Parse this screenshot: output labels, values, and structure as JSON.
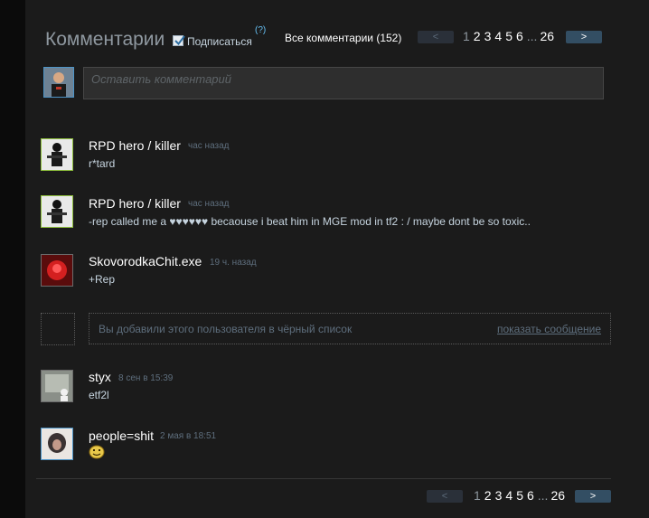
{
  "header": {
    "title": "Комментарии",
    "subscribe_label": "Подписаться",
    "help_mark": "(?)",
    "all_comments": "Все комментарии (152)"
  },
  "pager": {
    "prev_label": "<",
    "next_label": ">",
    "current": "1",
    "pages": [
      "2",
      "3",
      "4",
      "5",
      "6"
    ],
    "ellipsis": "...",
    "last": "26"
  },
  "composer": {
    "placeholder": "Оставить комментарий"
  },
  "comments": [
    {
      "author": "RPD hero / killer",
      "time": "час назад",
      "text": "r*tard"
    },
    {
      "author": "RPD hero / killer",
      "time": "час назад",
      "text": "-rep called me a ♥♥♥♥♥♥ becaouse i beat him in MGE mod in tf2 : / maybe dont be so toxic.."
    },
    {
      "author": "SkovorodkaChit.exe",
      "time": "19 ч. назад",
      "text": "+Rep"
    },
    {
      "author": "styx",
      "time": "8 сен в 15:39",
      "text": "etf2l"
    },
    {
      "author": "people=shit",
      "time": "2 мая в 18:51",
      "text": "",
      "emoticon": "smiley-emoticon-icon"
    }
  ],
  "blocked": {
    "text": "Вы добавили этого пользователя в чёрный список",
    "link": "показать сообщение"
  },
  "colors": {
    "accent": "#66c0f4",
    "next_button": "#334e63",
    "online_border": "#8fc03d"
  }
}
